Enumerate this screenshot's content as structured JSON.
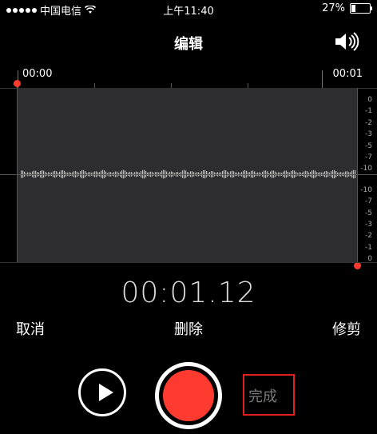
{
  "status_bar": {
    "carrier": "中国电信",
    "time": "上午11:40",
    "battery_percent": "27%",
    "battery_level": 0.27
  },
  "header": {
    "title": "编辑"
  },
  "timeline": {
    "start_label": "00:00",
    "end_label": "00:01"
  },
  "db_scale": [
    "0",
    "-1",
    "-2",
    "-3",
    "-5",
    "-7",
    "-10",
    "-10",
    "-7",
    "-5",
    "-3",
    "-2",
    "-1",
    "0"
  ],
  "timer": "00:01.12",
  "actions": {
    "cancel": "取消",
    "delete": "删除",
    "trim": "修剪"
  },
  "controls": {
    "done": "完成"
  },
  "colors": {
    "accent_red": "#ff3b30",
    "waveform_bg": "#2d2d2f"
  }
}
